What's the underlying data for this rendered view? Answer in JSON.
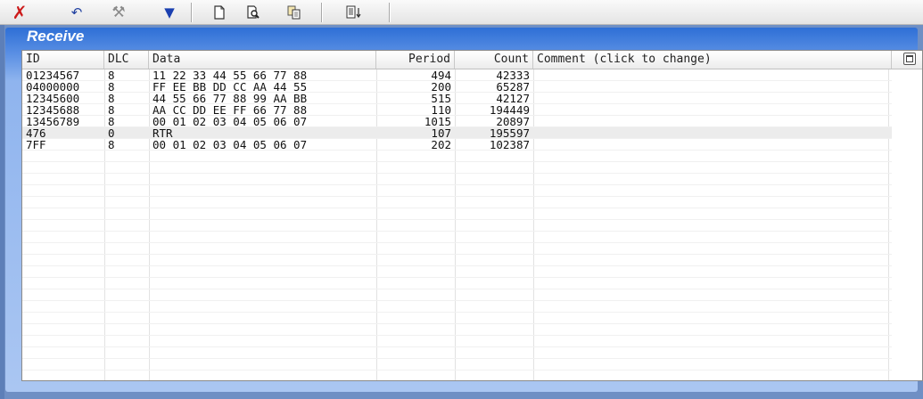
{
  "toolbar": {
    "buttons": [
      {
        "name": "clear-icon",
        "glyph": "✗",
        "color": "#cc1a1a"
      },
      {
        "name": "undo-icon",
        "glyph": "↶",
        "color": "#2040a0"
      },
      {
        "name": "tools-icon",
        "glyph": "⚒",
        "color": "#8a8a8a"
      },
      {
        "name": "filter-icon",
        "glyph": "▼",
        "color": "#1a3fb0"
      },
      {
        "name": "new-document-icon",
        "glyph": "🗋",
        "color": "#333333"
      },
      {
        "name": "print-preview-icon",
        "glyph": "🔍",
        "color": "#333333"
      },
      {
        "name": "copy-icon",
        "glyph": "⎘",
        "color": "#333333"
      },
      {
        "name": "export-icon",
        "glyph": "↧",
        "color": "#333333"
      }
    ]
  },
  "panel": {
    "title": "Receive"
  },
  "table": {
    "columns": [
      "ID",
      "DLC",
      "Data",
      "Period",
      "Count",
      "Comment (click to change)"
    ],
    "rows": [
      {
        "id": "01234567",
        "dlc": "8",
        "data": "11 22 33 44 55 66 77 88",
        "period": "494",
        "count": "42333",
        "comment": ""
      },
      {
        "id": "04000000",
        "dlc": "8",
        "data": "FF EE BB DD CC AA 44 55",
        "period": "200",
        "count": "65287",
        "comment": ""
      },
      {
        "id": "12345600",
        "dlc": "8",
        "data": "44 55 66 77 88 99 AA BB",
        "period": "515",
        "count": "42127",
        "comment": ""
      },
      {
        "id": "12345688",
        "dlc": "8",
        "data": "AA CC DD EE FF 66 77 88",
        "period": "110",
        "count": "194449",
        "comment": ""
      },
      {
        "id": "13456789",
        "dlc": "8",
        "data": "00 01 02 03 04 05 06 07",
        "period": "1015",
        "count": "20897",
        "comment": ""
      },
      {
        "id": "476",
        "dlc": "0",
        "data": "RTR",
        "period": "107",
        "count": "195597",
        "comment": "",
        "selected": true
      },
      {
        "id": "7FF",
        "dlc": "8",
        "data": "00 01 02 03 04 05 06 07",
        "period": "202",
        "count": "102387",
        "comment": ""
      }
    ]
  }
}
